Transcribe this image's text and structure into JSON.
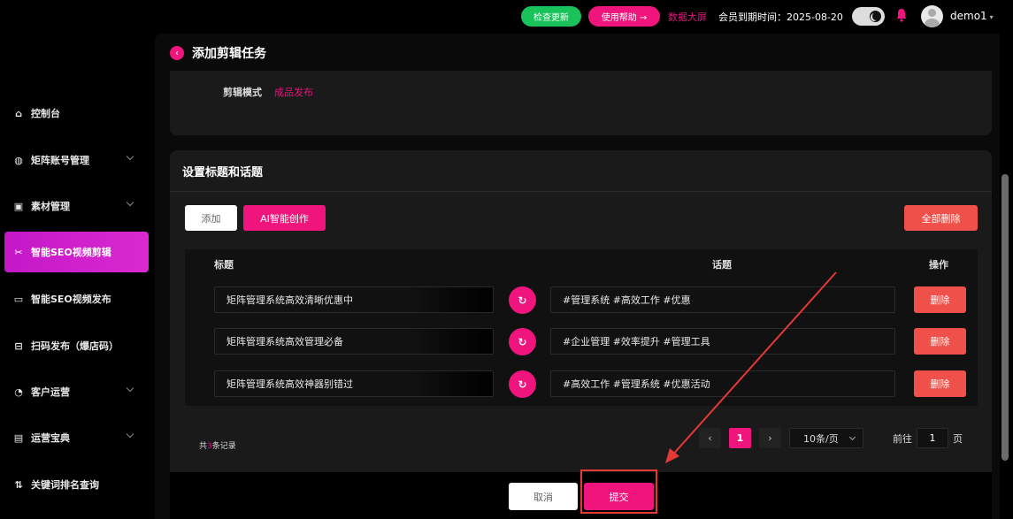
{
  "topbar": {
    "check_update": "检查更新",
    "help": "使用帮助 →",
    "dashboard": "数据大屏",
    "member_expire": "会员到期时间：2025-08-20",
    "username": "demo1",
    "user_caret": "▾"
  },
  "sidebar": {
    "items": [
      {
        "label": "控制台",
        "icon": "⌂"
      },
      {
        "label": "矩阵账号管理",
        "icon": "◍"
      },
      {
        "label": "素材管理",
        "icon": "▣"
      },
      {
        "label": "智能SEO视频剪辑",
        "icon": "✂"
      },
      {
        "label": "智能SEO视频发布",
        "icon": "▭"
      },
      {
        "label": "扫码发布（爆店码）",
        "icon": "⊟"
      },
      {
        "label": "客户运营",
        "icon": "◔"
      },
      {
        "label": "运营宝典",
        "icon": "▤"
      },
      {
        "label": "关键词排名查询",
        "icon": "⇅"
      }
    ]
  },
  "page": {
    "back_icon": "‹",
    "title": "添加剪辑任务",
    "mode_label": "剪辑模式",
    "mode_value": "成品发布"
  },
  "section": {
    "title": "设置标题和话题",
    "add": "添加",
    "ai_create": "AI智能创作",
    "delete_all": "全部删除"
  },
  "table": {
    "headers": {
      "title": "标题",
      "topic": "话题",
      "action": "操作"
    },
    "rows": [
      {
        "title": "矩阵管理系统高效清晰优惠中",
        "topic": "#管理系统 #高效工作 #优惠",
        "delete": "删除"
      },
      {
        "title": "矩阵管理系统高效管理必备",
        "topic": "#企业管理 #效率提升 #管理工具",
        "delete": "删除"
      },
      {
        "title": "矩阵管理系统高效神器别错过",
        "topic": "#高效工作 #管理系统 #优惠活动",
        "delete": "删除"
      }
    ],
    "refresh_icon": "↻"
  },
  "pagination": {
    "total_prefix": "共",
    "total_count": "3",
    "total_suffix": "条记录",
    "prev": "‹",
    "current": "1",
    "next": "›",
    "page_size": "10条/页",
    "goto_label": "前往",
    "goto_value": "1",
    "goto_unit": "页"
  },
  "footer": {
    "cancel": "取消",
    "submit": "提交"
  },
  "colors": {
    "accent": "#f0157d",
    "danger": "#f0504a",
    "success": "#19c25a",
    "annotation": "#e53935"
  }
}
